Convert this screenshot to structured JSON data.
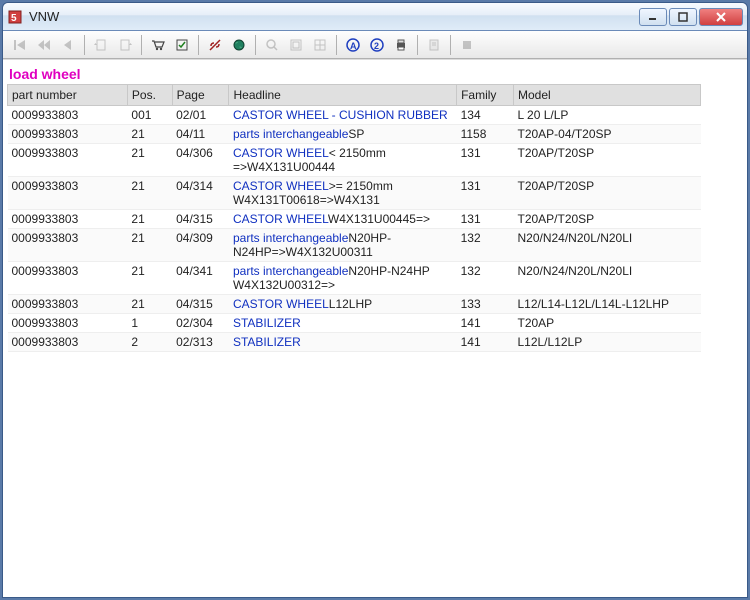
{
  "window": {
    "title": "VNW"
  },
  "search_term": "load wheel",
  "columns": {
    "part_number": "part number",
    "pos": "Pos.",
    "page": "Page",
    "headline": "Headline",
    "family": "Family",
    "model": "Model"
  },
  "rows": [
    {
      "part": "0009933803",
      "pos": "001",
      "page": "02/01",
      "head_link": "CASTOR WHEEL - CUSHION RUBBER",
      "head_rest": "",
      "family": "134",
      "model": "L 20 L/LP"
    },
    {
      "part": "0009933803",
      "pos": "21",
      "page": "04/11",
      "head_link": "parts interchangeable",
      "head_rest": "SP",
      "family": "1158",
      "model": "T20AP-04/T20SP"
    },
    {
      "part": "0009933803",
      "pos": "21",
      "page": "04/306",
      "head_link": "CASTOR WHEEL",
      "head_rest": "< 2150mm =>W4X131U00444",
      "family": "131",
      "model": "T20AP/T20SP"
    },
    {
      "part": "0009933803",
      "pos": "21",
      "page": "04/314",
      "head_link": "CASTOR WHEEL",
      "head_rest": ">= 2150mm W4X131T00618=>W4X131",
      "family": "131",
      "model": "T20AP/T20SP"
    },
    {
      "part": "0009933803",
      "pos": "21",
      "page": "04/315",
      "head_link": "CASTOR WHEEL",
      "head_rest": "W4X131U00445=>",
      "family": "131",
      "model": "T20AP/T20SP"
    },
    {
      "part": "0009933803",
      "pos": "21",
      "page": "04/309",
      "head_link": "parts interchangeable",
      "head_rest": "N20HP-N24HP=>W4X132U00311",
      "family": "132",
      "model": "N20/N24/N20L/N20LI"
    },
    {
      "part": "0009933803",
      "pos": "21",
      "page": "04/341",
      "head_link": "parts interchangeable",
      "head_rest": "N20HP-N24HP W4X132U00312=>",
      "family": "132",
      "model": "N20/N24/N20L/N20LI"
    },
    {
      "part": "0009933803",
      "pos": "21",
      "page": "04/315",
      "head_link": "CASTOR WHEEL",
      "head_rest": "L12LHP",
      "family": "133",
      "model": "L12/L14-L12L/L14L-L12LHP"
    },
    {
      "part": "0009933803",
      "pos": "1",
      "page": "02/304",
      "head_link": "STABILIZER",
      "head_rest": "",
      "family": "141",
      "model": "T20AP"
    },
    {
      "part": "0009933803",
      "pos": "2",
      "page": "02/313",
      "head_link": "STABILIZER",
      "head_rest": "",
      "family": "141",
      "model": "L12L/L12LP"
    }
  ]
}
